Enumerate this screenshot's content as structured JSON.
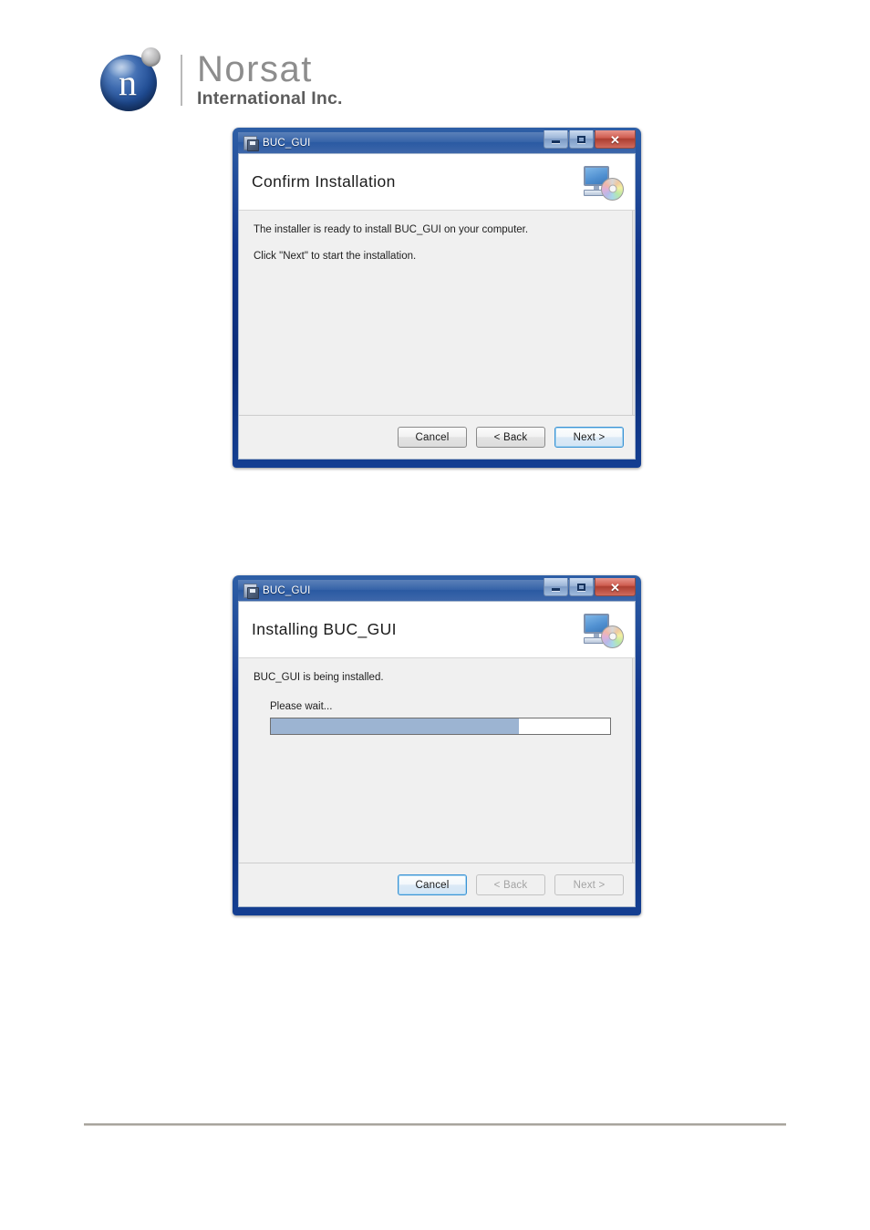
{
  "brand": {
    "logo_letter": "n",
    "name_top": "Norsat",
    "name_bottom": "International Inc."
  },
  "windows": [
    {
      "id": "confirm-installation",
      "title": "BUC_GUI",
      "title_icon": "installer-icon",
      "header_icon": "computer-cd-icon",
      "heading": "Confirm Installation",
      "body_lines": [
        "The installer is ready to install BUC_GUI on your computer.",
        "Click \"Next\" to start the installation."
      ],
      "buttons": {
        "cancel": "Cancel",
        "back": "< Back",
        "next": "Next >"
      },
      "window_controls": {
        "minimize": "minimize-icon",
        "maximize": "maximize-icon",
        "close": "✕"
      }
    },
    {
      "id": "installing",
      "title": "BUC_GUI",
      "title_icon": "installer-icon",
      "header_icon": "computer-cd-icon",
      "heading": "Installing BUC_GUI",
      "body_lines": [
        "BUC_GUI is being installed."
      ],
      "progress": {
        "label": "Please wait...",
        "percent": 73,
        "fill_color": "#9cb4d2"
      },
      "buttons": {
        "cancel": "Cancel",
        "back": "< Back",
        "next": "Next >"
      },
      "window_controls": {
        "minimize": "minimize-icon",
        "maximize": "maximize-icon",
        "close": "✕"
      }
    }
  ]
}
